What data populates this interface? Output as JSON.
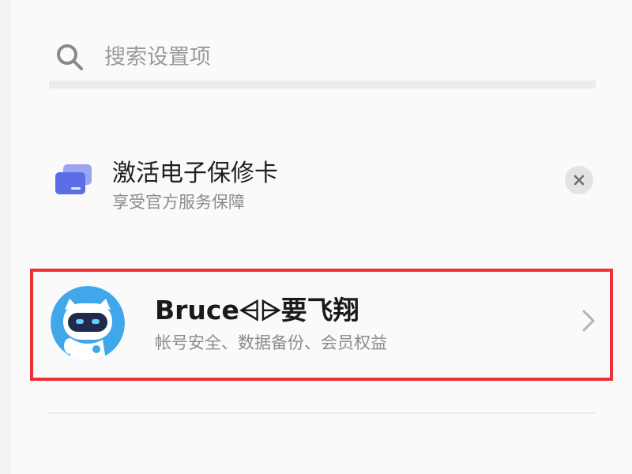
{
  "search": {
    "placeholder": "搜索设置项",
    "icon": "search-icon"
  },
  "warranty_card": {
    "title": "激活电子保修卡",
    "subtitle": "享受官方服务保障",
    "icon": "warranty-card-icon",
    "dismiss_icon": "close-icon"
  },
  "account": {
    "name": "Bruce⩤⩥要飞翔",
    "subtitle": "帐号安全、数据备份、会员权益",
    "avatar_icon": "robot-avatar",
    "chevron_icon": "chevron-right-icon"
  },
  "colors": {
    "highlight_border": "#ee2f33",
    "card_icon": "#5b6ee8",
    "avatar_bg": "#3fa7ea"
  }
}
